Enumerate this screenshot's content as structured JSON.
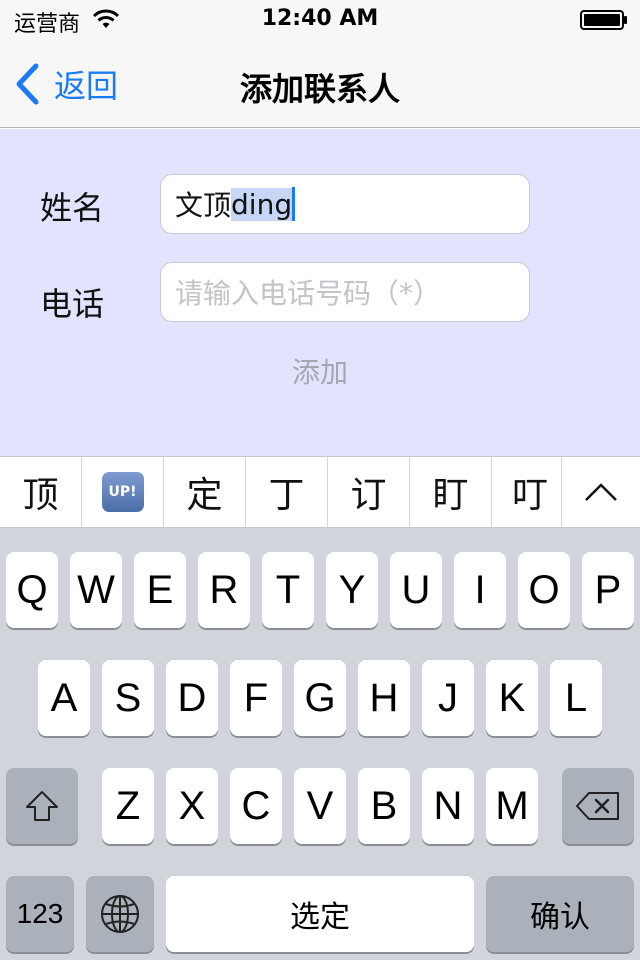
{
  "status_bar": {
    "carrier": "运营商",
    "time": "12:40 AM"
  },
  "nav": {
    "back_label": "返回",
    "title": "添加联系人"
  },
  "form": {
    "name_label": "姓名",
    "name_value_committed": "文顶",
    "name_value_composing": "ding",
    "phone_label": "电话",
    "phone_placeholder": "请输入电话号码（*）",
    "add_button_label": "添加"
  },
  "candidates": [
    "顶",
    "UP!",
    "定",
    "丁",
    "订",
    "盯",
    "叮"
  ],
  "keyboard": {
    "row1": [
      "Q",
      "W",
      "E",
      "R",
      "T",
      "Y",
      "U",
      "I",
      "O",
      "P"
    ],
    "row2": [
      "A",
      "S",
      "D",
      "F",
      "G",
      "H",
      "J",
      "K",
      "L"
    ],
    "row3": [
      "Z",
      "X",
      "C",
      "V",
      "B",
      "N",
      "M"
    ],
    "numbers_key": "123",
    "space_label": "选定",
    "return_label": "确认"
  },
  "colors": {
    "accent": "#1a7cf5",
    "form_background": "#e2e4fd",
    "keyboard_background": "#d1d5db"
  },
  "icons": [
    "wifi-icon",
    "battery-icon",
    "back-chevron-icon",
    "up-emoji-icon",
    "chevron-up-icon",
    "shift-icon",
    "globe-icon",
    "delete-icon"
  ]
}
